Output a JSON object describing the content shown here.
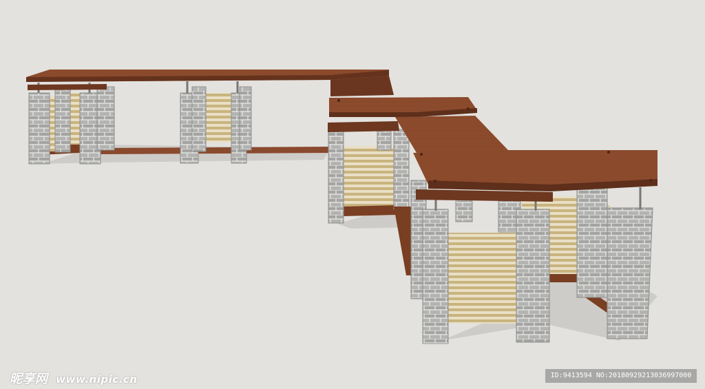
{
  "watermark": {
    "site_name": "昵享网",
    "url": "www.nipic.cn"
  },
  "image_id": {
    "text": "ID:9413594 NO:20180929213036997000"
  },
  "colors": {
    "background": "#e3e2df",
    "roof_wood": "#8a4a2e",
    "roof_edge": "#5e2f1b",
    "brick": "#a9a9a9",
    "slat": "#d8c79a"
  }
}
